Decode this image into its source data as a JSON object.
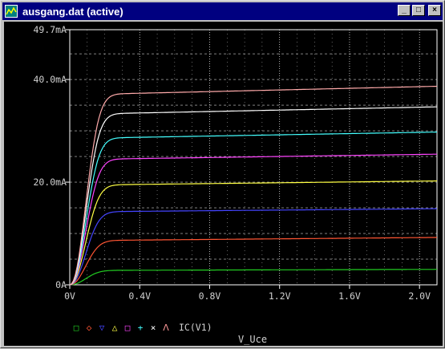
{
  "window": {
    "title": "ausgang.dat (active)"
  },
  "icons": {
    "app": "probe-app-icon",
    "minimize": "minimize-icon",
    "maximize": "maximize-icon",
    "close": "close-icon"
  },
  "colors": {
    "plot_bg": "#000000",
    "axis": "#ffffff",
    "grid": "#ffffff",
    "text": "#d0d0d0"
  },
  "legend": {
    "markers": [
      {
        "glyph": "□",
        "color": "#22cc22"
      },
      {
        "glyph": "◇",
        "color": "#ff5533"
      },
      {
        "glyph": "▽",
        "color": "#4444ff"
      },
      {
        "glyph": "△",
        "color": "#ffff44"
      },
      {
        "glyph": "□",
        "color": "#ff44ff"
      },
      {
        "glyph": "+",
        "color": "#44ffff"
      },
      {
        "glyph": "×",
        "color": "#ffffff"
      },
      {
        "glyph": "ᐱ",
        "color": "#ff9999"
      }
    ],
    "label": "IC(V1)"
  },
  "chart_data": {
    "type": "line",
    "xlabel": "V_Uce",
    "ylabel": "",
    "xlim": [
      0,
      2.1
    ],
    "ylim": [
      0,
      0.0497
    ],
    "x_ticks": [
      "0V",
      "0.4V",
      "0.8V",
      "1.2V",
      "1.6V",
      "2.0V"
    ],
    "x_tick_values": [
      0,
      0.4,
      0.8,
      1.2,
      1.6,
      2.0
    ],
    "y_ticks": [
      "0A",
      "20.0mA",
      "40.0mA",
      "49.7mA"
    ],
    "y_tick_values": [
      0,
      0.02,
      0.04,
      0.0497
    ],
    "grid": true,
    "series": [
      {
        "color": "#22cc22",
        "sat": 0.0028,
        "slope": 0.0001
      },
      {
        "color": "#ff5533",
        "sat": 0.0086,
        "slope": 0.0003
      },
      {
        "color": "#4444ff",
        "sat": 0.0142,
        "slope": 0.0003
      },
      {
        "color": "#ffff44",
        "sat": 0.0194,
        "slope": 0.0004
      },
      {
        "color": "#ff44ff",
        "sat": 0.0244,
        "slope": 0.0005
      },
      {
        "color": "#44ffff",
        "sat": 0.0285,
        "slope": 0.0006
      },
      {
        "color": "#ffffff",
        "sat": 0.0332,
        "slope": 0.0007
      },
      {
        "color": "#ffaaaa",
        "sat": 0.037,
        "slope": 0.0008
      }
    ]
  }
}
